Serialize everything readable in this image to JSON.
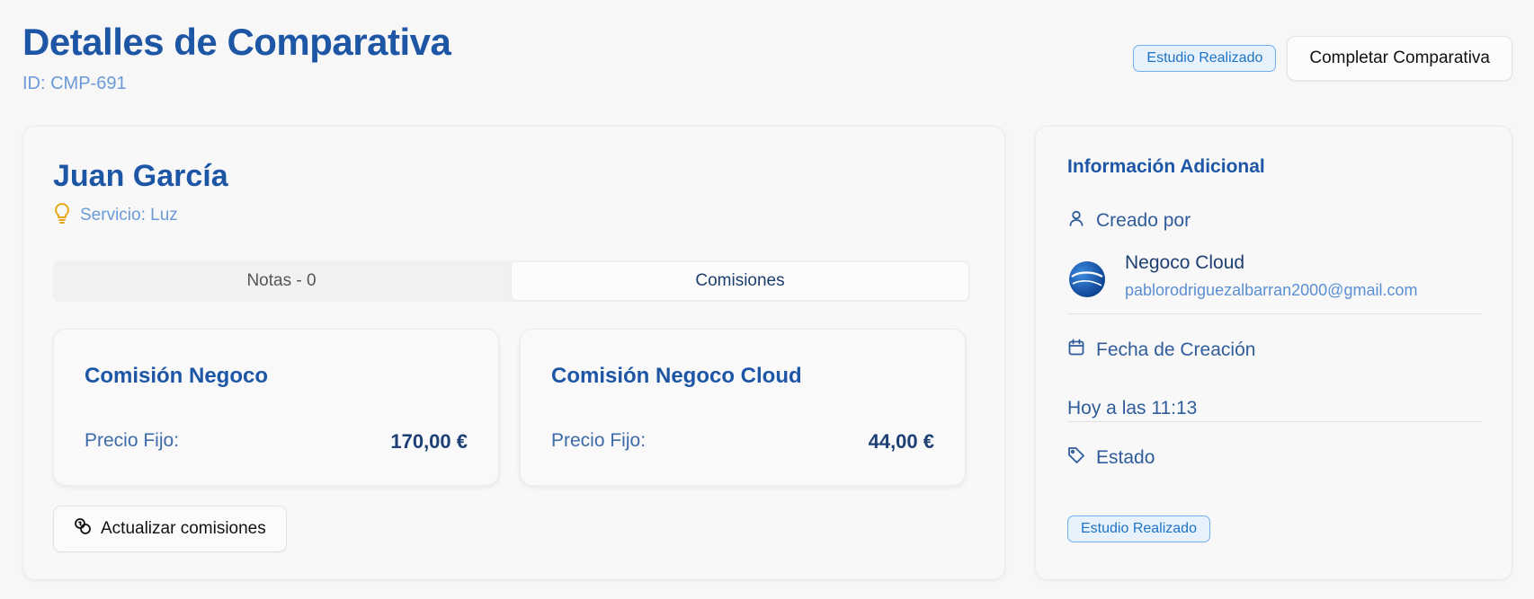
{
  "header": {
    "title": "Detalles de Comparativa",
    "id_text": "ID: CMP-691",
    "status_badge": "Estudio Realizado",
    "complete_button": "Completar Comparativa"
  },
  "customer": {
    "name": "Juan García",
    "service": "Servicio: Luz"
  },
  "tabs": [
    {
      "label": "Notas - 0",
      "active": false
    },
    {
      "label": "Comisiones",
      "active": true
    }
  ],
  "commissions": [
    {
      "title": "Comisión Negoco",
      "label": "Precio Fijo:",
      "value": "170,00 €"
    },
    {
      "title": "Comisión Negoco Cloud",
      "label": "Precio Fijo:",
      "value": "44,00 €"
    }
  ],
  "update_button": "Actualizar comisiones",
  "side": {
    "title": "Información Adicional",
    "created_by_label": "Creado por",
    "user_name": "Negoco Cloud",
    "user_email": "pablorodriguezalbarran2000@gmail.com",
    "date_label": "Fecha de Creación",
    "date_value": "Hoy a las 11:13",
    "status_label": "Estado",
    "status_value": "Estudio Realizado"
  },
  "colors": {
    "primary": "#1e56a6",
    "accent_light": "#6a9ad7",
    "badge_border": "#6fb0ee",
    "badge_bg": "#e7f2fd",
    "bulb_icon": "#e6a817"
  },
  "icons": [
    "lightbulb-icon",
    "coins-icon",
    "user-icon",
    "calendar-icon",
    "tag-icon"
  ]
}
